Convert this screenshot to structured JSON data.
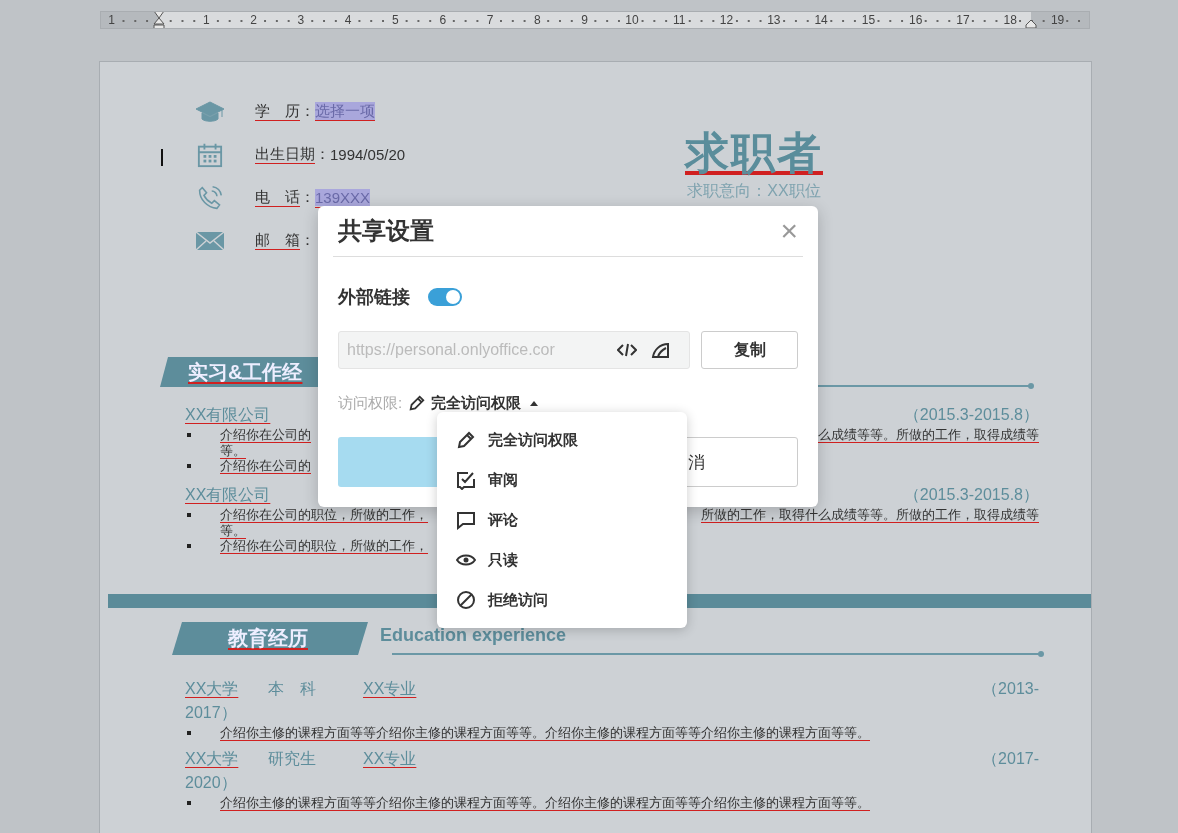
{
  "ruler": {
    "labels": [
      "1",
      "1",
      "2",
      "3",
      "4",
      "5",
      "6",
      "7",
      "8",
      "9",
      "10",
      "11",
      "12",
      "13",
      "14",
      "15",
      "16",
      "17",
      "18",
      "19"
    ]
  },
  "resume": {
    "contacts": [
      {
        "kind": "education",
        "label": "学　历",
        "colon": "：",
        "value": "选择一项",
        "highlighted": true
      },
      {
        "kind": "birthday",
        "label": "出生日期",
        "colon": "：",
        "value": "1994/05/20",
        "highlighted": false
      },
      {
        "kind": "phone",
        "label": "电　话",
        "colon": "：",
        "value": "139XXX",
        "highlighted": true
      },
      {
        "kind": "email",
        "label": "邮　箱",
        "colon": "："
      }
    ],
    "name": "求职者",
    "objective": "求职意向：XX职位",
    "work_section": {
      "title": "实习&工作经"
    },
    "work_entries": [
      {
        "company": "XX有限公司",
        "period": "（2015.3-2015.8）",
        "bullets": [
          {
            "left": "介绍你在公司的",
            "right": "么成绩等等。所做的工作，取得成绩等",
            "continuation": "等。"
          },
          {
            "left": "介绍你在公司的"
          }
        ]
      },
      {
        "company": "XX有限公司",
        "period": "（2015.3-2015.8）",
        "bullets": [
          {
            "left": "介绍你在公司的职位，所做的工作，",
            "right": "所做的工作，取得什么成绩等等。所做的工作，取得成绩等",
            "continuation": "等。"
          },
          {
            "left": "介绍你在公司的职位，所做的工作，"
          }
        ]
      }
    ],
    "education_section": {
      "title": "教育经历",
      "subtitle": "Education experience"
    },
    "education_entries": [
      {
        "school": "XX大学",
        "degree": "本　科",
        "major": "XX专业",
        "period_start": "（2013-",
        "period_end": "2017）",
        "courses": "介绍你主修的课程方面等等介绍你主修的课程方面等等。介绍你主修的课程方面等等介绍你主修的课程方面等等。"
      },
      {
        "school": "XX大学",
        "degree": "研究生",
        "major": "XX专业",
        "period_start": "（2017-",
        "period_end": "2020）",
        "courses": "介绍你主修的课程方面等等介绍你主修的课程方面等等。介绍你主修的课程方面等等介绍你主修的课程方面等等。"
      }
    ]
  },
  "dialog": {
    "title": "共享设置",
    "close": "×",
    "external_link": {
      "label": "外部链接",
      "on": true
    },
    "link_field": {
      "value": "https://personal.onlyoffice.cor"
    },
    "copy_button": "复制",
    "access": {
      "label": "访问权限:",
      "value": "完全访问权限",
      "expanded": true
    },
    "buttons": [
      {
        "kind": "primary"
      },
      {
        "kind": "secondary",
        "label": "消"
      }
    ],
    "menu": [
      {
        "kind": "full",
        "label": "完全访问权限"
      },
      {
        "kind": "review",
        "label": "审阅"
      },
      {
        "kind": "comment",
        "label": "评论"
      },
      {
        "kind": "read",
        "label": "只读"
      },
      {
        "kind": "deny",
        "label": "拒绝访问"
      }
    ]
  }
}
